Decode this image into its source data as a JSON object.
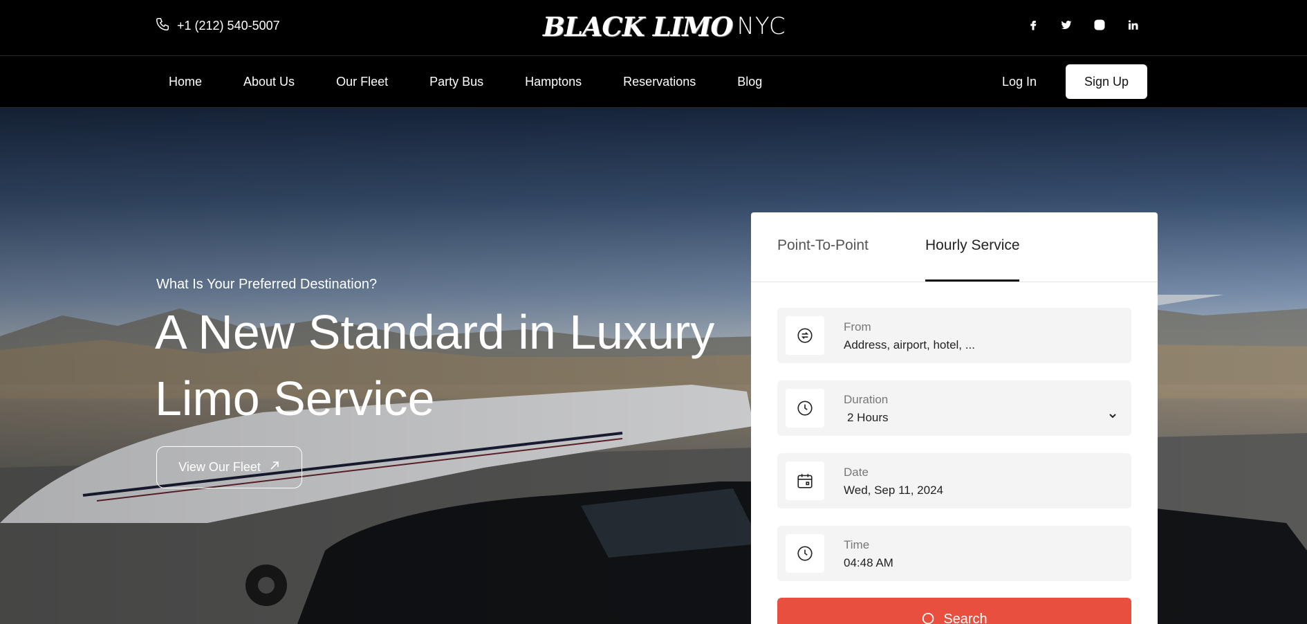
{
  "topbar": {
    "phone": "+1 (212) 540-5007",
    "logo_black": "BLACK LIMO",
    "logo_nyc": "NYC",
    "socials": [
      "facebook-icon",
      "twitter-icon",
      "instagram-icon",
      "linkedin-icon"
    ]
  },
  "nav": {
    "items": [
      "Home",
      "About Us",
      "Our Fleet",
      "Party Bus",
      "Hamptons",
      "Reservations",
      "Blog"
    ],
    "login": "Log In",
    "signup": "Sign Up"
  },
  "hero": {
    "kicker": "What Is Your Preferred Destination?",
    "headline": "A New Standard in Luxury Limo Service",
    "cta": "View Our Fleet"
  },
  "booking": {
    "tabs": [
      "Point-To-Point",
      "Hourly Service"
    ],
    "active_tab": "Hourly Service",
    "from": {
      "label": "From",
      "placeholder": "Address, airport, hotel, ..."
    },
    "duration": {
      "label": "Duration",
      "value": "2 Hours"
    },
    "date": {
      "label": "Date",
      "value": "Wed, Sep 11, 2024"
    },
    "time": {
      "label": "Time",
      "value": "04:48 AM"
    },
    "search": "Search"
  },
  "colors": {
    "accent": "#e94f3f",
    "topbar": "#000000",
    "card": "#ffffff",
    "field": "#f4f4f4"
  }
}
